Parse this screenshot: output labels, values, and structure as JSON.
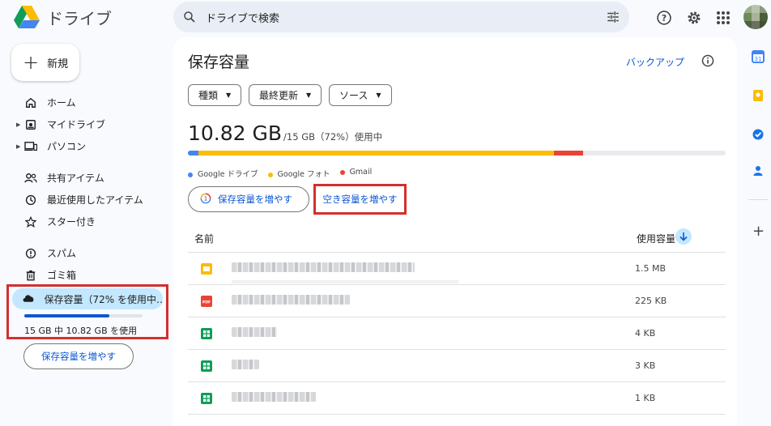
{
  "header": {
    "app_title": "ドライブ",
    "search_placeholder": "ドライブで検索"
  },
  "sidebar": {
    "new_label": "新規",
    "group1": [
      {
        "label": "ホーム",
        "icon": "home-icon",
        "arrow": false
      },
      {
        "label": "マイドライブ",
        "icon": "my-drive-icon",
        "arrow": true
      },
      {
        "label": "パソコン",
        "icon": "computers-icon",
        "arrow": true
      }
    ],
    "group2": [
      {
        "label": "共有アイテム",
        "icon": "shared-icon"
      },
      {
        "label": "最近使用したアイテム",
        "icon": "clock-icon"
      },
      {
        "label": "スター付き",
        "icon": "star-icon"
      }
    ],
    "group3": [
      {
        "label": "スパム",
        "icon": "spam-icon"
      },
      {
        "label": "ゴミ箱",
        "icon": "trash-icon"
      }
    ],
    "storage_label": "保存容量（72% を使用中…",
    "storage_used_fraction": 0.72,
    "storage_text": "15 GB 中 10.82 GB を使用",
    "increase_button": "保存容量を増やす"
  },
  "main": {
    "title": "保存容量",
    "backup_link": "バックアップ",
    "filters": [
      "種類",
      "最終更新",
      "ソース"
    ],
    "usage_big": "10.82 GB",
    "usage_small": "/15 GB（72%）使用中",
    "breakdown": [
      {
        "name": "Google ドライブ",
        "color": "#4285f4",
        "percent": 2
      },
      {
        "name": "Google フォト",
        "color": "#fbbc04",
        "percent": 66
      },
      {
        "name": "Gmail",
        "color": "#ea4335",
        "percent": 5.5
      }
    ],
    "increase_button": "保存容量を増やす",
    "free_up_button": "空き容量を増やす",
    "col_name": "名前",
    "col_size": "使用容量",
    "rows": [
      {
        "type": "slides",
        "size": "1.5 MB"
      },
      {
        "type": "pdf",
        "size": "225 KB"
      },
      {
        "type": "sheets",
        "size": "4 KB"
      },
      {
        "type": "sheets",
        "size": "3 KB"
      },
      {
        "type": "sheets",
        "size": "1 KB"
      }
    ]
  },
  "colors": {
    "accent": "#0b57d0",
    "highlight": "#d32f2f",
    "selected": "#c2e7ff"
  }
}
